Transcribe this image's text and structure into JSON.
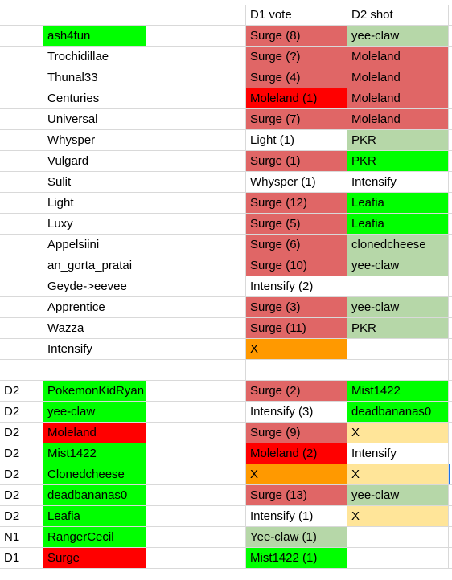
{
  "palette": {
    "green": "#00ff00",
    "light_green": "#b6d7a8",
    "red_soft": "#e06666",
    "red": "#ff0000",
    "orange": "#ff9900",
    "light_orange": "#ffe599",
    "white": "#ffffff"
  },
  "headers": {
    "d1": "D1 vote",
    "d2": "D2 shot"
  },
  "rows": [
    {
      "label": "",
      "name": "ash4fun",
      "name_bg": "green",
      "d1": "Surge (8)",
      "d1_bg": "red_soft",
      "d2": "yee-claw",
      "d2_bg": "light_green"
    },
    {
      "label": "",
      "name": "Trochidillae",
      "name_bg": "",
      "d1": "Surge (?)",
      "d1_bg": "red_soft",
      "d2": "Moleland",
      "d2_bg": "red_soft"
    },
    {
      "label": "",
      "name": "Thunal33",
      "name_bg": "",
      "d1": "Surge (4)",
      "d1_bg": "red_soft",
      "d2": "Moleland",
      "d2_bg": "red_soft"
    },
    {
      "label": "",
      "name": "Centuries",
      "name_bg": "",
      "d1": "Moleland (1)",
      "d1_bg": "red",
      "d2": "Moleland",
      "d2_bg": "red_soft"
    },
    {
      "label": "",
      "name": "Universal",
      "name_bg": "",
      "d1": "Surge (7)",
      "d1_bg": "red_soft",
      "d2": "Moleland",
      "d2_bg": "red_soft"
    },
    {
      "label": "",
      "name": "Whysper",
      "name_bg": "",
      "d1": "Light (1)",
      "d1_bg": "",
      "d2": "PKR",
      "d2_bg": "light_green"
    },
    {
      "label": "",
      "name": "Vulgard",
      "name_bg": "",
      "d1": "Surge (1)",
      "d1_bg": "red_soft",
      "d2": "PKR",
      "d2_bg": "green"
    },
    {
      "label": "",
      "name": "Sulit",
      "name_bg": "",
      "d1": "Whysper (1)",
      "d1_bg": "",
      "d2": "Intensify",
      "d2_bg": ""
    },
    {
      "label": "",
      "name": "Light",
      "name_bg": "",
      "d1": "Surge (12)",
      "d1_bg": "red_soft",
      "d2": "Leafia",
      "d2_bg": "green"
    },
    {
      "label": "",
      "name": "Luxy",
      "name_bg": "",
      "d1": "Surge (5)",
      "d1_bg": "red_soft",
      "d2": "Leafia",
      "d2_bg": "green"
    },
    {
      "label": "",
      "name": "Appelsiini",
      "name_bg": "",
      "d1": "Surge (6)",
      "d1_bg": "red_soft",
      "d2": "clonedcheese",
      "d2_bg": "light_green"
    },
    {
      "label": "",
      "name": "an_gorta_pratai",
      "name_bg": "",
      "d1": "Surge (10)",
      "d1_bg": "red_soft",
      "d2": "yee-claw",
      "d2_bg": "light_green"
    },
    {
      "label": "",
      "name": "Geyde->eevee",
      "name_bg": "",
      "d1": "Intensify (2)",
      "d1_bg": "",
      "d2": "",
      "d2_bg": ""
    },
    {
      "label": "",
      "name": "Apprentice",
      "name_bg": "",
      "d1": "Surge (3)",
      "d1_bg": "red_soft",
      "d2": "yee-claw",
      "d2_bg": "light_green"
    },
    {
      "label": "",
      "name": "Wazza",
      "name_bg": "",
      "d1": "Surge (11)",
      "d1_bg": "red_soft",
      "d2": "PKR",
      "d2_bg": "light_green"
    },
    {
      "label": "",
      "name": "Intensify",
      "name_bg": "",
      "d1": "X",
      "d1_bg": "orange",
      "d2": "",
      "d2_bg": ""
    },
    {
      "label": "",
      "name": "",
      "name_bg": "",
      "d1": "",
      "d1_bg": "",
      "d2": "",
      "d2_bg": ""
    },
    {
      "label": "D2",
      "name": "PokemonKidRyan",
      "name_bg": "green",
      "d1": "Surge (2)",
      "d1_bg": "red_soft",
      "d2": "Mist1422",
      "d2_bg": "green"
    },
    {
      "label": "D2",
      "name": "yee-claw",
      "name_bg": "green",
      "d1": "Intensify (3)",
      "d1_bg": "",
      "d2": "deadbananas0",
      "d2_bg": "green"
    },
    {
      "label": "D2",
      "name": "Moleland",
      "name_bg": "red",
      "d1": "Surge (9)",
      "d1_bg": "red_soft",
      "d2": "X",
      "d2_bg": "light_orange"
    },
    {
      "label": "D2",
      "name": "Mist1422",
      "name_bg": "green",
      "d1": "Moleland (2)",
      "d1_bg": "red",
      "d2": "Intensify",
      "d2_bg": ""
    },
    {
      "label": "D2",
      "name": "Clonedcheese",
      "name_bg": "green",
      "d1": "X",
      "d1_bg": "orange",
      "d2": "X",
      "d2_bg": "light_orange"
    },
    {
      "label": "D2",
      "name": "deadbananas0",
      "name_bg": "green",
      "d1": "Surge (13)",
      "d1_bg": "red_soft",
      "d2": "yee-claw",
      "d2_bg": "light_green"
    },
    {
      "label": "D2",
      "name": "Leafia",
      "name_bg": "green",
      "d1": "Intensify (1)",
      "d1_bg": "",
      "d2": "X",
      "d2_bg": "light_orange"
    },
    {
      "label": "N1",
      "name": "RangerCecil",
      "name_bg": "green",
      "d1": "Yee-claw (1)",
      "d1_bg": "light_green",
      "d2": "",
      "d2_bg": ""
    },
    {
      "label": "D1",
      "name": "Surge",
      "name_bg": "red",
      "d1": "Mist1422 (1)",
      "d1_bg": "green",
      "d2": "",
      "d2_bg": ""
    }
  ]
}
